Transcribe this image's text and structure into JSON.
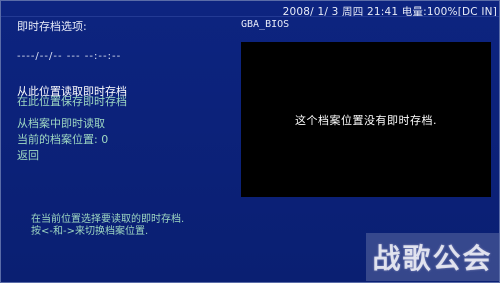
{
  "status_bar": {
    "text": "2008/ 1/ 3 周四 21:41 电量:100%[DC IN]"
  },
  "left_panel": {
    "title": "即时存档选项:",
    "slot_info": "----/--/-- --- --:--:--",
    "menu_items": [
      {
        "label": "从此位置读取即时存档",
        "state": "selected"
      },
      {
        "label": "在此位置保存即时存档",
        "state": "enabled"
      },
      {
        "label": "从档案中即时读取",
        "state": "enabled"
      },
      {
        "label": "当前的档案位置: 0",
        "state": "enabled"
      },
      {
        "label": "返回",
        "state": "enabled"
      }
    ],
    "help_lines": [
      "在当前位置选择要读取的即时存档.",
      "按<-和->来切换档案位置."
    ]
  },
  "right_panel": {
    "game_title": "GBA_BIOS",
    "preview_message": "这个档案位置没有即时存档."
  },
  "watermark": {
    "text": "战歌公会"
  },
  "colors": {
    "background": "#0c2178",
    "selected_text": "#ffffff",
    "enabled_text": "#9fd8c2",
    "preview_bg": "#000000"
  }
}
